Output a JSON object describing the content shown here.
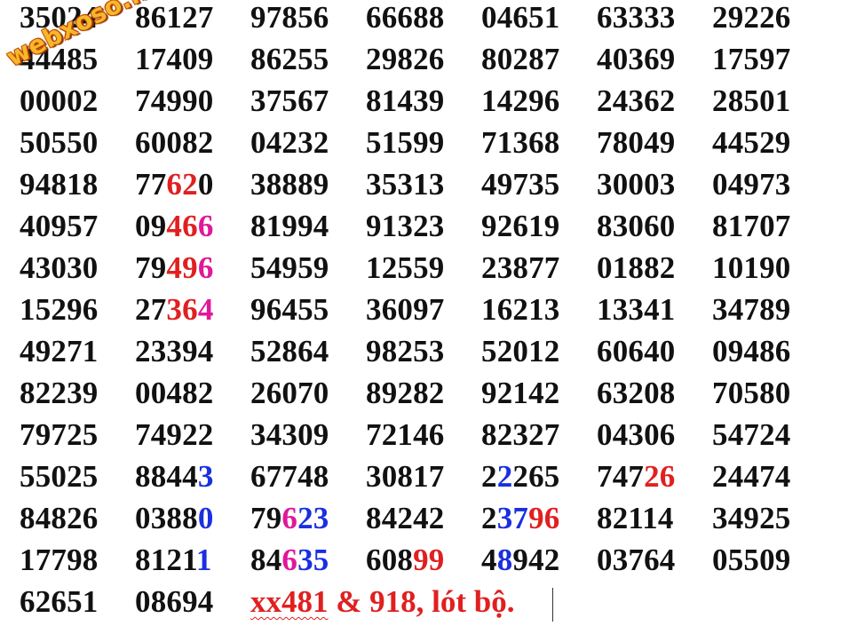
{
  "colors": {
    "text": "#111111",
    "red": "#e02020",
    "pink": "#e0189a",
    "blue": "#1a2fe0"
  },
  "watermark": "webxoso.net",
  "rows": [
    [
      [
        [
          "35024"
        ]
      ],
      [
        [
          "86127"
        ]
      ],
      [
        [
          "97856"
        ]
      ],
      [
        [
          "66688"
        ]
      ],
      [
        [
          "04651"
        ]
      ],
      [
        [
          "63333"
        ]
      ],
      [
        [
          "29226"
        ]
      ]
    ],
    [
      [
        [
          "44485"
        ]
      ],
      [
        [
          "17409"
        ]
      ],
      [
        [
          "86255"
        ]
      ],
      [
        [
          "29826"
        ]
      ],
      [
        [
          "80287"
        ]
      ],
      [
        [
          "40369"
        ]
      ],
      [
        [
          "17597"
        ]
      ]
    ],
    [
      [
        [
          "00002"
        ]
      ],
      [
        [
          "74990"
        ]
      ],
      [
        [
          "37567"
        ]
      ],
      [
        [
          "81439"
        ]
      ],
      [
        [
          "14296"
        ]
      ],
      [
        [
          "24362"
        ]
      ],
      [
        [
          "28501"
        ]
      ]
    ],
    [
      [
        [
          "50550"
        ]
      ],
      [
        [
          "60082"
        ]
      ],
      [
        [
          "04232"
        ]
      ],
      [
        [
          "51599"
        ]
      ],
      [
        [
          "71368"
        ]
      ],
      [
        [
          "78049"
        ]
      ],
      [
        [
          "44529"
        ]
      ]
    ],
    [
      [
        [
          "94818"
        ]
      ],
      [
        [
          "77"
        ],
        [
          "62",
          "red"
        ],
        [
          "0"
        ]
      ],
      [
        [
          "38889"
        ]
      ],
      [
        [
          "35313"
        ]
      ],
      [
        [
          "49735"
        ]
      ],
      [
        [
          "30003"
        ]
      ],
      [
        [
          "04973"
        ]
      ]
    ],
    [
      [
        [
          "40957"
        ]
      ],
      [
        [
          "09"
        ],
        [
          "46",
          "red"
        ],
        [
          "6",
          "pink"
        ]
      ],
      [
        [
          "81994"
        ]
      ],
      [
        [
          "91323"
        ]
      ],
      [
        [
          "92619"
        ]
      ],
      [
        [
          "83060"
        ]
      ],
      [
        [
          "81707"
        ]
      ]
    ],
    [
      [
        [
          "43030"
        ]
      ],
      [
        [
          "79"
        ],
        [
          "49",
          "red"
        ],
        [
          "6",
          "pink"
        ]
      ],
      [
        [
          "54959"
        ]
      ],
      [
        [
          "12559"
        ]
      ],
      [
        [
          "23877"
        ]
      ],
      [
        [
          "01882"
        ]
      ],
      [
        [
          "10190"
        ]
      ]
    ],
    [
      [
        [
          "15296"
        ]
      ],
      [
        [
          "27"
        ],
        [
          "36",
          "red"
        ],
        [
          "4",
          "pink"
        ]
      ],
      [
        [
          "96455"
        ]
      ],
      [
        [
          "36097"
        ]
      ],
      [
        [
          "16213"
        ]
      ],
      [
        [
          "13341"
        ]
      ],
      [
        [
          "34789"
        ]
      ]
    ],
    [
      [
        [
          "49271"
        ]
      ],
      [
        [
          "23394"
        ]
      ],
      [
        [
          "52864"
        ]
      ],
      [
        [
          "98253"
        ]
      ],
      [
        [
          "52012"
        ]
      ],
      [
        [
          "60640"
        ]
      ],
      [
        [
          "09486"
        ]
      ]
    ],
    [
      [
        [
          "82239"
        ]
      ],
      [
        [
          "00482"
        ]
      ],
      [
        [
          "26070"
        ]
      ],
      [
        [
          "89282"
        ]
      ],
      [
        [
          "92142"
        ]
      ],
      [
        [
          "63208"
        ]
      ],
      [
        [
          "70580"
        ]
      ]
    ],
    [
      [
        [
          "79725"
        ]
      ],
      [
        [
          "74922"
        ]
      ],
      [
        [
          "34309"
        ]
      ],
      [
        [
          "72146"
        ]
      ],
      [
        [
          "82327"
        ]
      ],
      [
        [
          "04306"
        ]
      ],
      [
        [
          "54724"
        ]
      ]
    ],
    [
      [
        [
          "55025"
        ]
      ],
      [
        [
          "8844"
        ],
        [
          "3",
          "blue"
        ]
      ],
      [
        [
          "67748"
        ]
      ],
      [
        [
          "30817"
        ]
      ],
      [
        [
          "2"
        ],
        [
          "2",
          "blue"
        ],
        [
          "265"
        ]
      ],
      [
        [
          "747"
        ],
        [
          "26",
          "red"
        ]
      ],
      [
        [
          "24474"
        ]
      ]
    ],
    [
      [
        [
          "84826"
        ]
      ],
      [
        [
          "0388"
        ],
        [
          "0",
          "blue"
        ]
      ],
      [
        [
          "79"
        ],
        [
          "6",
          "pink"
        ],
        [
          "23",
          "blue"
        ]
      ],
      [
        [
          "84242"
        ]
      ],
      [
        [
          "2"
        ],
        [
          "37",
          "blue"
        ],
        [
          "96",
          "red"
        ]
      ],
      [
        [
          "82114"
        ]
      ],
      [
        [
          "34925"
        ]
      ]
    ],
    [
      [
        [
          "17798"
        ]
      ],
      [
        [
          "8121"
        ],
        [
          "1",
          "blue"
        ]
      ],
      [
        [
          "84"
        ],
        [
          "6",
          "pink"
        ],
        [
          "35",
          "blue"
        ]
      ],
      [
        [
          "608"
        ],
        [
          "99",
          "red"
        ]
      ],
      [
        [
          "4"
        ],
        [
          "8",
          "blue"
        ],
        [
          "942"
        ]
      ],
      [
        [
          "03764"
        ]
      ],
      [
        [
          "05509"
        ]
      ]
    ],
    [
      [
        [
          "62651"
        ]
      ],
      [
        [
          "08694"
        ]
      ]
    ]
  ],
  "note": {
    "part1": "xx481",
    "part2": " & 918, lót bộ."
  }
}
